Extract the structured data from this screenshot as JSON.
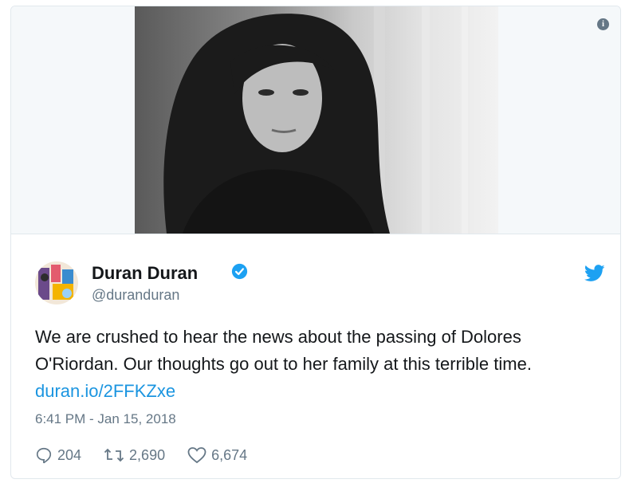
{
  "tweet": {
    "author_name": "Duran Duran",
    "handle": "@duranduran",
    "text_line1": "We are crushed to hear the news about the passing of Dolores",
    "text_line2": "O'Riordan. Our thoughts go out to her family at this terrible time.",
    "link": "duran.io/2FFKZxe",
    "timestamp": "6:41 PM - Jan 15, 2018",
    "replies": "204",
    "retweets": "2,690",
    "likes": "6,674"
  },
  "icons": {
    "info": "info-icon",
    "verified": "verified-badge-icon",
    "twitter": "twitter-bird-icon",
    "reply": "reply-icon",
    "retweet": "retweet-icon",
    "like": "heart-icon"
  },
  "colors": {
    "link": "#1b95e0",
    "twitter_blue": "#1da1f2",
    "muted": "#657786",
    "text": "#14171a"
  }
}
